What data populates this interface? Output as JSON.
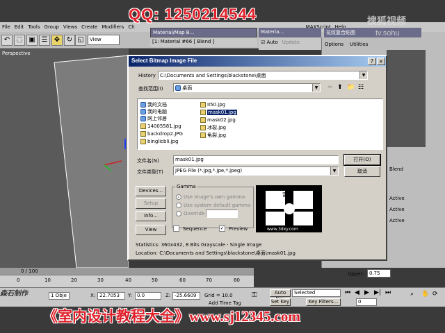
{
  "overlay": {
    "qq": "QQ: 1250214544",
    "sohu_logo": "搜狐视频",
    "sohu_url": "tv.sohu",
    "banner": "《室内设计教程大全》www.sj12345.com",
    "maker": "森石制作"
  },
  "max": {
    "menu": [
      "File",
      "Edit",
      "Tools",
      "Group",
      "Views",
      "Create",
      "Modifiers",
      "Ch"
    ],
    "menu_right": [
      "MAXScript",
      "Help"
    ],
    "view_dropdown": "View",
    "viewport_label": "Perspective",
    "material_title": "Material/Map B...",
    "material_row": "[1: Material #66 [ Blend ]",
    "material2_title": "Materia...",
    "auto_label": "Auto",
    "update_label": "Update",
    "cn_title": "花纹复合贴图",
    "options_label": "Options",
    "utilities_label": "Utilities",
    "blend_label": "Blend",
    "active_labels": [
      "Active",
      "Active",
      "Active"
    ],
    "upper_label": "Upper:",
    "upper_value": "0.75",
    "timeline_label": "0 / 100",
    "ruler_ticks": [
      "0",
      "10",
      "20",
      "30",
      "40",
      "50",
      "60",
      "70",
      "80"
    ],
    "status": {
      "obj": "1 Obje",
      "x_label": "X:",
      "x_value": "22.7053",
      "y_label": "Y:",
      "y_value": "0.0",
      "z_label": "Z:",
      "z_value": "-25.6609",
      "grid": "Grid = 10.0",
      "auto_key": "Auto Key",
      "selected": "Selected",
      "set_key": "Set Key",
      "key_filters": "Key Filters...",
      "add_time_tag": "Add Time Tag",
      "frame": "0"
    }
  },
  "dialog": {
    "title": "Select Bitmap Image File",
    "history_label": "History",
    "history_path": "C:\\Documents and Settings\\blackstone\\桌面",
    "lookin_label": "查找范围(I)",
    "lookin_value": "桌面",
    "files": [
      {
        "name": "我的文档",
        "kind": "sys"
      },
      {
        "name": "我的电脑",
        "kind": "sys"
      },
      {
        "name": "网上邻居",
        "kind": "sys"
      },
      {
        "name": "14005581.jpg",
        "kind": "jpg"
      },
      {
        "name": "backdrop2.JPG",
        "kind": "jpg"
      },
      {
        "name": "binglicbli.jpg",
        "kind": "jpg"
      },
      {
        "name": "II50.jpg",
        "kind": "jpg"
      },
      {
        "name": "mask01.jpg",
        "kind": "jpg",
        "selected": true
      },
      {
        "name": "mask02.jpg",
        "kind": "jpg"
      },
      {
        "name": "冰裂.jpg",
        "kind": "jpg"
      },
      {
        "name": "龟裂.jpg",
        "kind": "jpg"
      }
    ],
    "filename_label": "文件名(N)",
    "filename_value": "mask01.jpg",
    "filetype_label": "文件类型(T)",
    "filetype_value": "JPEG File (*.jpg,*.jpe,*.jpeg)",
    "open_button": "打开(O)",
    "cancel_button": "取消",
    "devices_button": "Devices...",
    "setup_button": "Setup",
    "info_button": "Info...",
    "view_button": "View",
    "gamma_label": "Gamma",
    "gamma_options": [
      "Use image's own gamma",
      "Use system default gamma",
      "Override"
    ],
    "gamma_override_value": "",
    "sequence_label": "Sequence",
    "preview_label": "Preview",
    "preview_text": "富号",
    "preview_url": "www.3dxy.com",
    "statistics": "Statistics:  360x432, 8 Bits Grayscale - Single Image",
    "location": "Location:  C:\\Documents and Settings\\blackstone\\桌面\\mask01.jpg"
  }
}
